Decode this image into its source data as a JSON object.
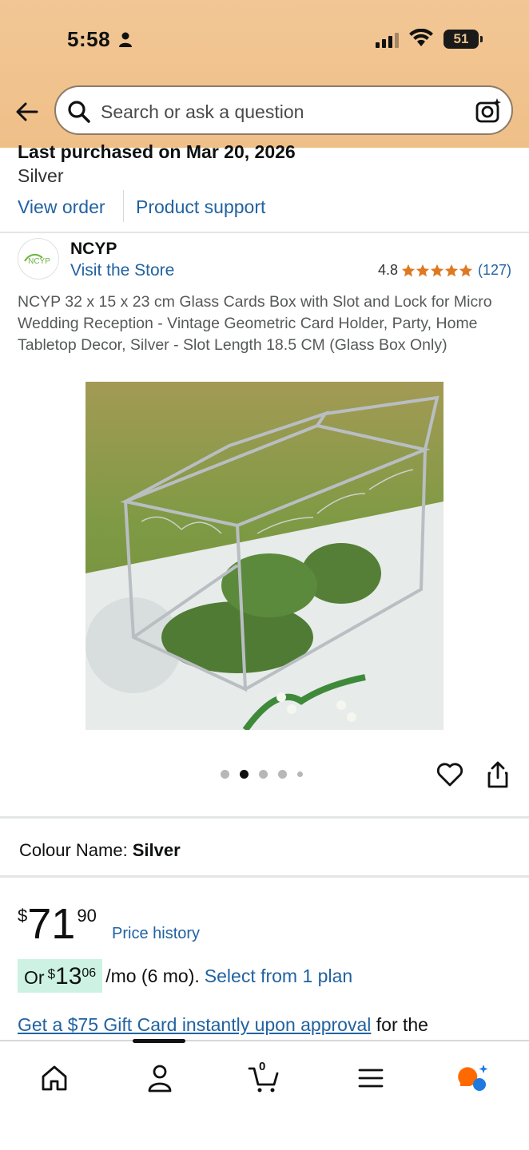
{
  "status_bar": {
    "time": "5:58",
    "battery": "51"
  },
  "search": {
    "placeholder": "Search or ask a question"
  },
  "purchase": {
    "title": "Last purchased on Mar 20, 2026",
    "variant": "Silver",
    "view_order": "View order",
    "product_support": "Product support"
  },
  "brand": {
    "name": "NCYP",
    "visit_store": "Visit the Store",
    "rating": "4.8",
    "rating_count": "(127)",
    "logo_text": "NCYP"
  },
  "product": {
    "title": "NCYP 32 x 15 x 23 cm Glass Cards Box with Slot and Lock for Micro Wedding Reception - Vintage Geometric Card Holder, Party, Home Tabletop Decor, Silver - Slot Length 18.5 CM (Glass Box Only)",
    "image_slide_count": 5,
    "active_slide": 2
  },
  "colour": {
    "label": "Colour Name:",
    "value": "Silver"
  },
  "price": {
    "symbol": "$",
    "whole": "71",
    "fraction": "90",
    "history_link": "Price history"
  },
  "installment": {
    "or": "Or",
    "symbol": "$",
    "whole": "13",
    "fraction": "06",
    "rest": "/mo (6 mo).",
    "select": "Select from 1 plan"
  },
  "gift": {
    "link": "Get a $75 Gift Card instantly upon approval",
    "suffix": "for the"
  },
  "bottom_nav": {
    "cart_count": "0",
    "items": [
      "home-icon",
      "account-icon",
      "cart-icon",
      "menu-icon",
      "rufus-icon"
    ]
  },
  "colors": {
    "header": "#f2c795",
    "link": "#2162a1",
    "star": "#de7921",
    "installment_bg": "#cdf2e3",
    "rufus": "#ff6a00"
  }
}
